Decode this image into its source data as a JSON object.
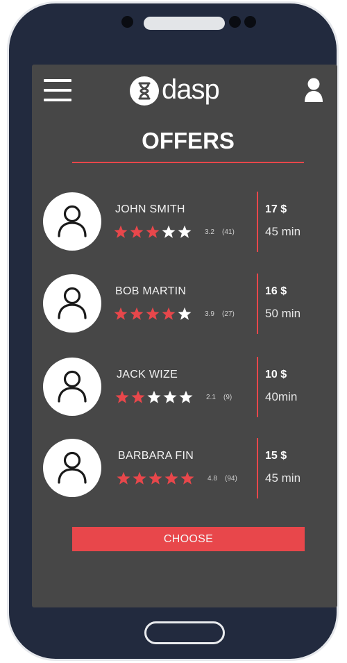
{
  "app": {
    "logo_text": "dasp"
  },
  "page": {
    "title": "OFFERS"
  },
  "colors": {
    "accent": "#e8474b",
    "screen_bg": "#474747",
    "phone_body": "#222a3e"
  },
  "offers": [
    {
      "name": "JOHN SMITH",
      "rating": "3.2",
      "stars_filled": 3,
      "reviews": "(41)",
      "price": "17 $",
      "time": "45 min"
    },
    {
      "name": "BOB MARTIN",
      "rating": "3.9",
      "stars_filled": 4,
      "reviews": "(27)",
      "price": "16 $",
      "time": "50 min"
    },
    {
      "name": "JACK WIZE",
      "rating": "2.1",
      "stars_filled": 2,
      "reviews": "(9)",
      "price": "10 $",
      "time": "40min"
    },
    {
      "name": "BARBARA FIN",
      "rating": "4.8",
      "stars_filled": 5,
      "reviews": "(94)",
      "price": "15 $",
      "time": "45 min"
    }
  ],
  "buttons": {
    "choose_label": "CHOOSE"
  },
  "icons": {
    "menu": "hamburger-menu-icon",
    "profile": "user-profile-icon",
    "avatar": "person-icon",
    "star": "star-icon",
    "logo": "hourglass-icon"
  }
}
